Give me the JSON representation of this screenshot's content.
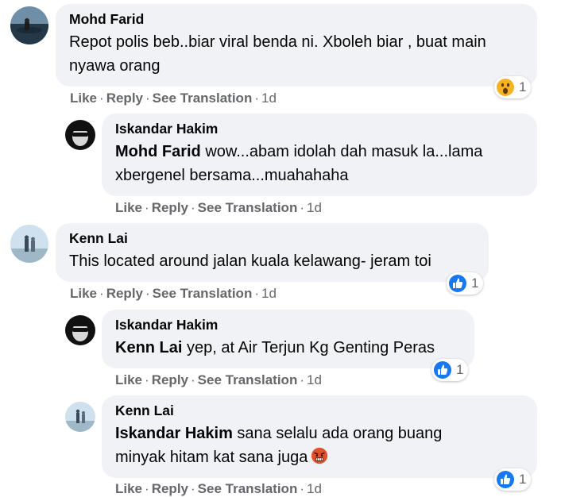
{
  "comments": [
    {
      "author": "Mohd Farid",
      "text": "Repot polis beb..biar viral benda ni. Xboleh biar , buat main nyawa orang",
      "reaction_count": "1",
      "reaction_icon": "wow-icon",
      "actions": {
        "like": "Like",
        "reply": "Reply",
        "translate": "See Translation",
        "time": "1d"
      }
    },
    {
      "author": "Iskandar Hakim",
      "mention": "Mohd Farid",
      "text": " wow...abam idolah dah masuk la...lama xbergenel bersama...muahahaha",
      "actions": {
        "like": "Like",
        "reply": "Reply",
        "translate": "See Translation",
        "time": "1d"
      }
    },
    {
      "author": "Kenn Lai",
      "text": "This located around jalan kuala kelawang- jeram toi",
      "reaction_count": "1",
      "reaction_icon": "like-icon",
      "actions": {
        "like": "Like",
        "reply": "Reply",
        "translate": "See Translation",
        "time": "1d"
      }
    },
    {
      "author": "Iskandar Hakim",
      "mention": "Kenn Lai",
      "text": " yep, at Air Terjun Kg Genting Peras",
      "reaction_count": "1",
      "reaction_icon": "like-icon",
      "actions": {
        "like": "Like",
        "reply": "Reply",
        "translate": "See Translation",
        "time": "1d"
      }
    },
    {
      "author": "Kenn Lai",
      "mention": "Iskandar Hakim",
      "text": " sana selalu ada orang buang minyak hitam kat sana juga",
      "inline_emoji": "angry-face-icon",
      "reaction_count": "1",
      "reaction_icon": "like-icon",
      "actions": {
        "like": "Like",
        "reply": "Reply",
        "translate": "See Translation",
        "time": "1d"
      }
    }
  ],
  "separator": "·",
  "colors": {
    "bubble": "#f0f2f5",
    "meta": "#65676b",
    "like_blue": "#1877f2",
    "wow_yellow": "#f7b125"
  }
}
